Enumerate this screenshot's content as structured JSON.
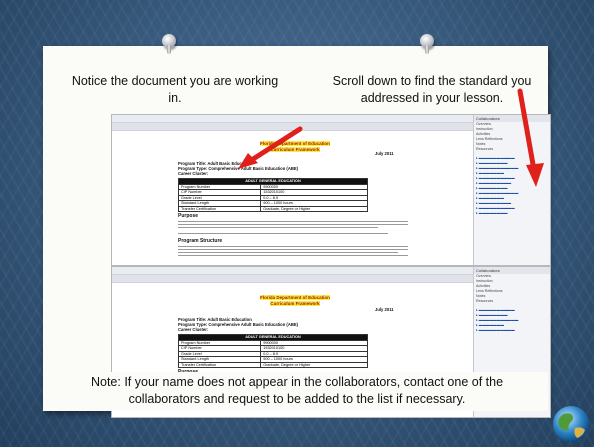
{
  "notes": {
    "top_left": "Notice the document you are working in.",
    "top_right": "Scroll down to find the standard you addressed in your lesson.",
    "bottom": "Note: If your name does not appear in the collaborators, contact one of the collaborators and request to be added to the list if necessary."
  },
  "colors": {
    "arrow": "#e0201a",
    "doc_title": "#b0101a",
    "highlight": "#f6ef3a"
  },
  "screenshot": {
    "date": "July 2011",
    "doc_title_1": "Florida Department of Education",
    "doc_title_2": "Curriculum Framework",
    "program_title": "Program Title:  Adult Basic Education",
    "program_type": "Program Type:  Comprehensive Adult Basic Education (ABE)",
    "career_cluster": "Career Cluster:",
    "table_header": "ADULT GENERAL EDUCATION",
    "table_rows": [
      [
        "Program Number",
        "9900000"
      ],
      [
        "CIP Number",
        "1532010100"
      ],
      [
        "Grade Level",
        "0.0 – 8.9"
      ],
      [
        "Standard Length",
        "900 – 1000 hours"
      ],
      [
        "Transfer Certification",
        "Graduate, Degree or Higher"
      ]
    ],
    "section_purpose": "Purpose",
    "section_structure": "Program Structure",
    "sidebar_header": "Collaborators",
    "sidebar_rows": [
      "Overview",
      "Instruction",
      "Activities",
      "Lens Reflections",
      "Notes",
      "Resources"
    ]
  },
  "icons": {
    "pin": "pushpin-icon",
    "globe": "globe-icon"
  }
}
